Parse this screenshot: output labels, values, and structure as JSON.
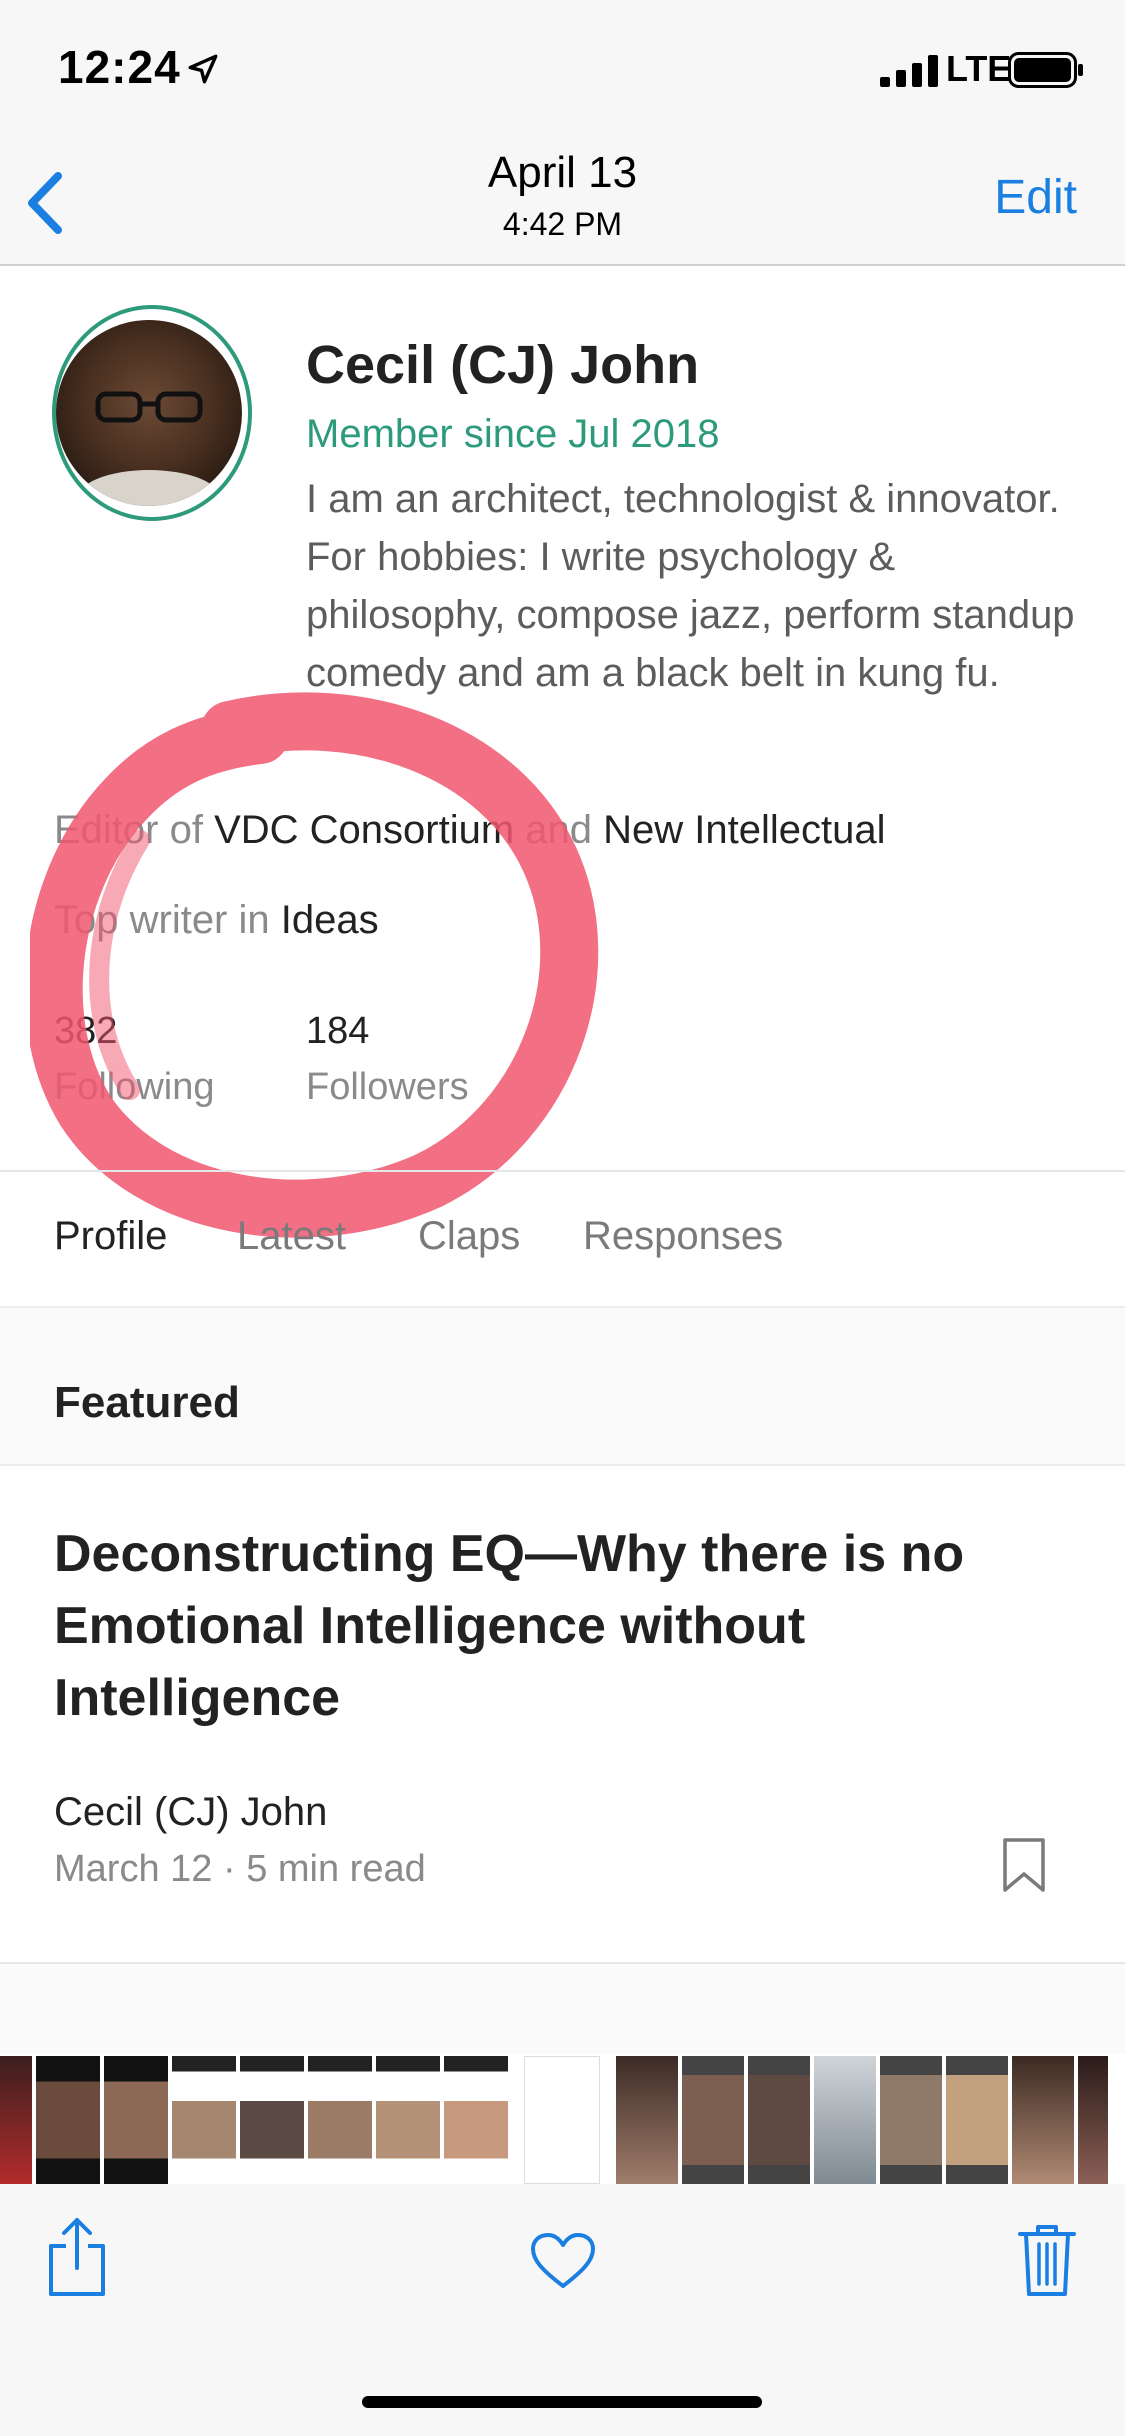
{
  "status_bar": {
    "time": "12:24",
    "network": "LTE"
  },
  "nav": {
    "date": "April 13",
    "time": "4:42 PM",
    "edit_label": "Edit"
  },
  "profile": {
    "name": "Cecil (CJ) John",
    "member_since": "Member since Jul 2018",
    "bio": "I am an architect, technologist & innovator. For hobbies: I write psychology & philosophy, compose jazz, perform standup comedy and am a black belt in kung fu.",
    "editor_prefix": "Editor of ",
    "editor_pub_1": "VDC Consortium",
    "editor_and": " and ",
    "editor_pub_2": "New Intellectual",
    "top_writer_prefix": "Top writer in ",
    "top_writer_topic": "Ideas",
    "following_count": "382",
    "following_label": "Following",
    "followers_count": "184",
    "followers_label": "Followers"
  },
  "tabs": [
    {
      "label": "Profile",
      "active": true
    },
    {
      "label": "Latest",
      "active": false
    },
    {
      "label": "Claps",
      "active": false
    },
    {
      "label": "Responses",
      "active": false
    }
  ],
  "featured": {
    "heading": "Featured",
    "article": {
      "title": "Deconstructing EQ—Why there is no Emotional Intelligence without Intelligence",
      "author": "Cecil (CJ) John",
      "date": "March 12",
      "separator": "·",
      "read_time": "5 min read"
    }
  },
  "icons": {
    "location": "location-arrow-icon",
    "signal": "cellular-signal-icon",
    "battery": "battery-icon",
    "back": "chevron-left-icon",
    "bookmark": "bookmark-icon",
    "share": "share-icon",
    "heart": "heart-icon",
    "trash": "trash-icon"
  },
  "colors": {
    "accent_blue": "#1a7fe0",
    "medium_green": "#2e9a7c",
    "annotation_red": "#f0566e"
  }
}
